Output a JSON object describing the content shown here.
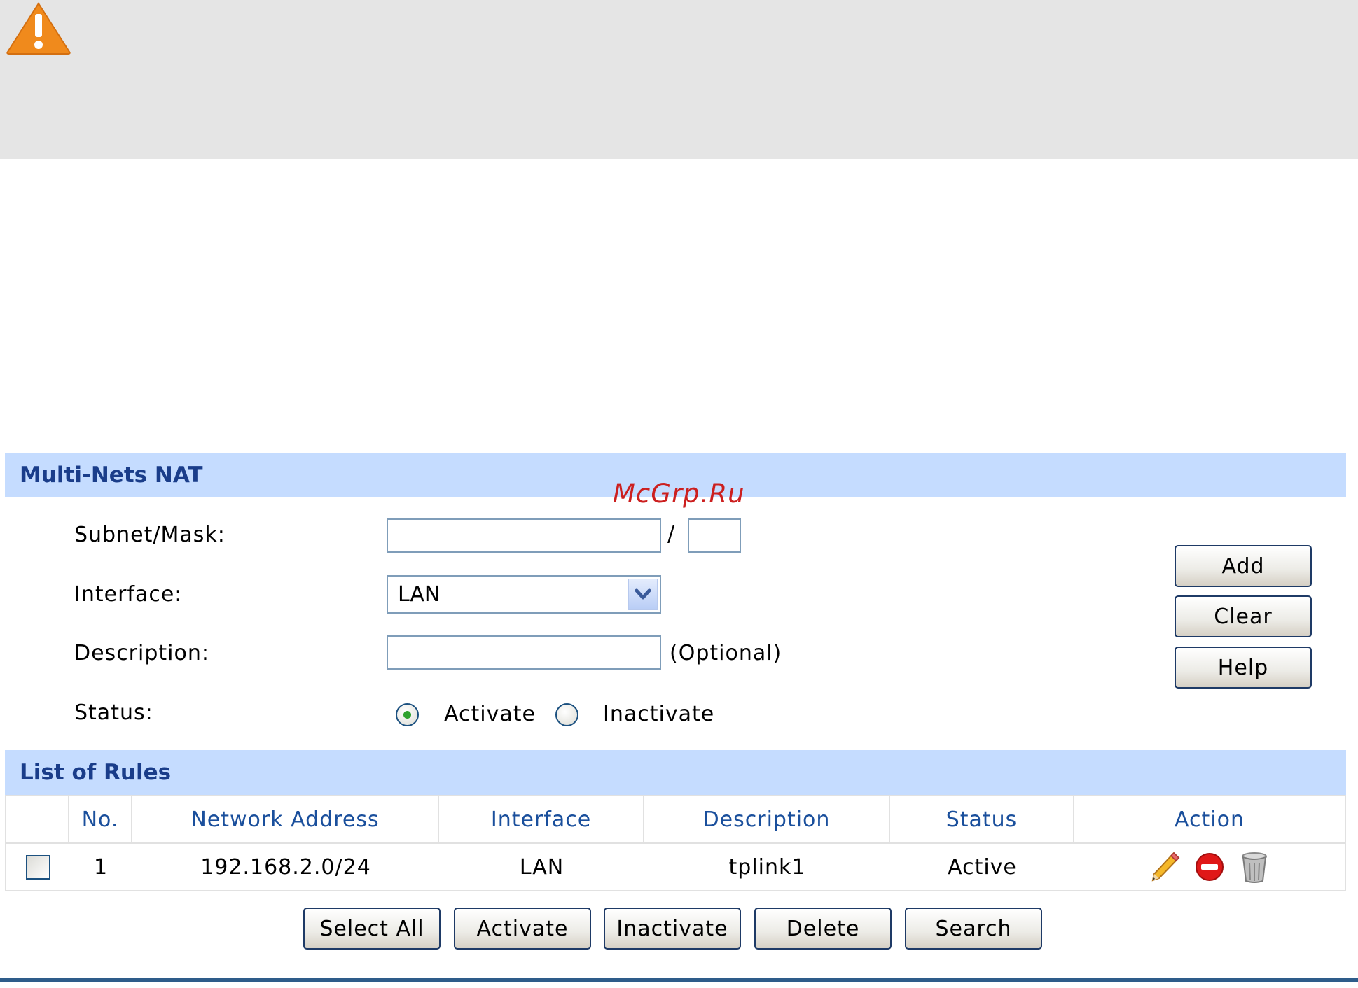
{
  "warning": {
    "icon": "warning-icon"
  },
  "watermark": "McGrp.Ru",
  "form_section": {
    "title": "Multi-Nets NAT",
    "subnet_label": "Subnet/Mask:",
    "subnet_value": "",
    "mask_separator": "/",
    "mask_value": "",
    "interface_label": "Interface:",
    "interface_selected": "LAN",
    "description_label": "Description:",
    "description_value": "",
    "optional_hint": "(Optional)",
    "status_label": "Status:",
    "status_options": [
      "Activate",
      "Inactivate"
    ],
    "status_selected": "Activate",
    "buttons": {
      "add": "Add",
      "clear": "Clear",
      "help": "Help"
    }
  },
  "rules_section": {
    "title": "List of Rules",
    "columns": [
      "No.",
      "Network Address",
      "Interface",
      "Description",
      "Status",
      "Action"
    ],
    "rows": [
      {
        "no": "1",
        "network_address": "192.168.2.0/24",
        "interface": "LAN",
        "description": "tplink1",
        "status": "Active",
        "actions": [
          "edit-pencil-icon",
          "disable-icon",
          "trash-icon"
        ]
      }
    ],
    "buttons": {
      "select_all": "Select All",
      "activate": "Activate",
      "inactivate": "Inactivate",
      "delete": "Delete",
      "search": "Search"
    }
  },
  "colors": {
    "header_bg": "#c5dcff",
    "header_text": "#1a3d8a",
    "column_text": "#1a4f9c",
    "warning_bg": "#e5e5e5",
    "watermark": "#cc1f1f"
  }
}
